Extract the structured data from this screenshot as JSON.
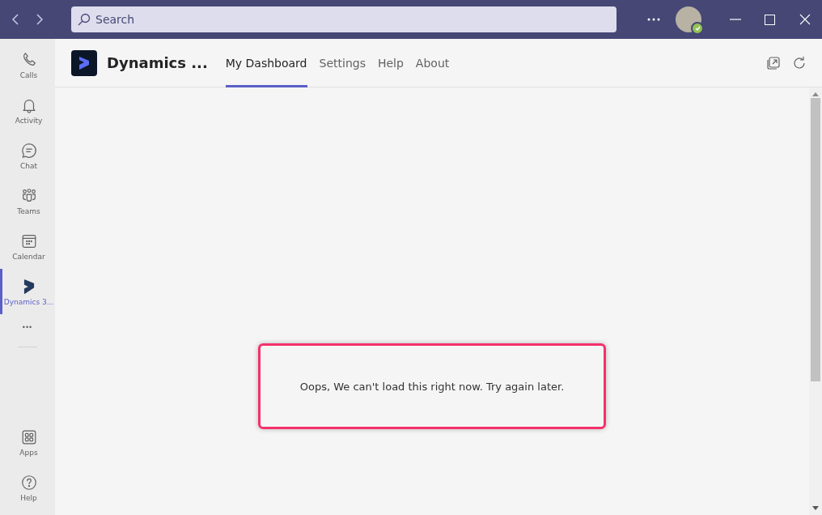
{
  "titlebar": {
    "search": {
      "placeholder": "Search"
    }
  },
  "rail": {
    "items": [
      {
        "label": "Calls",
        "selected": false
      },
      {
        "label": "Activity",
        "selected": false
      },
      {
        "label": "Chat",
        "selected": false
      },
      {
        "label": "Teams",
        "selected": false
      },
      {
        "label": "Calendar",
        "selected": false
      },
      {
        "label": "Dynamics 3...",
        "selected": true
      }
    ],
    "more": "•••",
    "bottom_items": [
      {
        "label": "Apps",
        "selected": false
      },
      {
        "label": "Help",
        "selected": false
      }
    ]
  },
  "app_header": {
    "title": "Dynamics ...",
    "tabs": [
      {
        "label": "My Dashboard",
        "selected": true
      },
      {
        "label": "Settings",
        "selected": false
      },
      {
        "label": "Help",
        "selected": false
      },
      {
        "label": "About",
        "selected": false
      }
    ]
  },
  "content": {
    "message": "Oops, We can't load this right now. Try again later."
  }
}
